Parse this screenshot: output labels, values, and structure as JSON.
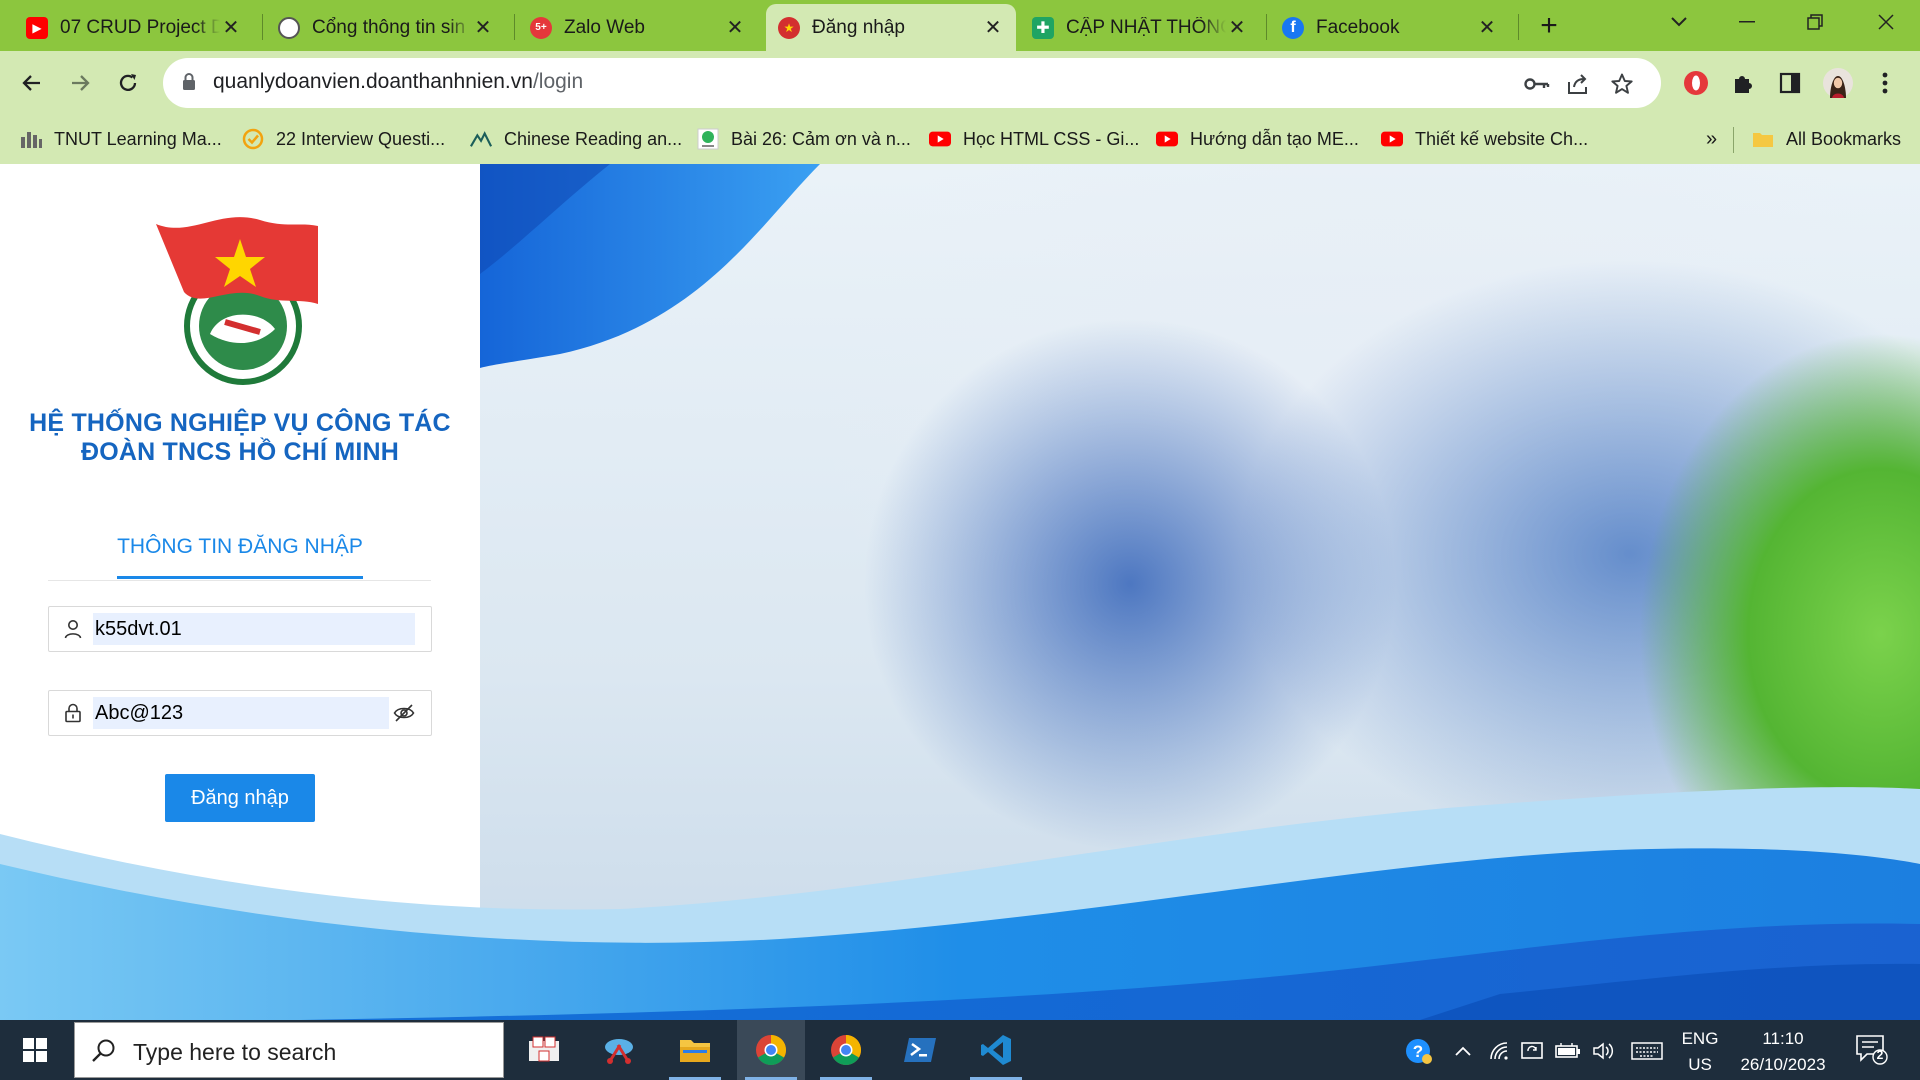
{
  "browser": {
    "tabs": [
      {
        "title": "07 CRUD Project D",
        "favicon": "youtube-icon",
        "active": false
      },
      {
        "title": "Cổng thông tin sin",
        "favicon": "university-icon",
        "active": false
      },
      {
        "title": "Zalo Web",
        "favicon": "zalo-icon",
        "active": false
      },
      {
        "title": "Đăng nhập",
        "favicon": "youth-union-icon",
        "active": true
      },
      {
        "title": "CẬP NHẬT THÔNG",
        "favicon": "sheets-icon",
        "active": false
      },
      {
        "title": "Facebook",
        "favicon": "facebook-icon",
        "active": false
      }
    ],
    "new_tab": "+",
    "address": {
      "host": "quanlydoanvien.doanthanhnien.vn",
      "path": "/login"
    },
    "bookmarks": [
      {
        "label": "TNUT Learning Ma...",
        "icon": "tnut-icon"
      },
      {
        "label": "22 Interview Questi...",
        "icon": "check-circle-icon"
      },
      {
        "label": "Chinese Reading an...",
        "icon": "mountain-icon"
      },
      {
        "label": "Bài 26: Cảm ơn và n...",
        "icon": "globe-icon"
      },
      {
        "label": "Học HTML CSS - Gi...",
        "icon": "youtube-icon"
      },
      {
        "label": "Hướng dẫn tạo ME...",
        "icon": "youtube-icon"
      },
      {
        "label": "Thiết kế website Ch...",
        "icon": "youtube-icon"
      }
    ],
    "bookmarks_overflow": "»",
    "all_bookmarks": "All Bookmarks"
  },
  "login": {
    "brand_line1": "HỆ THỐNG NGHIỆP VỤ CÔNG TÁC",
    "brand_line2": "ĐOÀN TNCS HỒ CHÍ MINH",
    "tab_title": "THÔNG TIN ĐĂNG NHẬP",
    "username": "k55dvt.01",
    "password": "Abc@123",
    "submit_label": "Đăng nhập"
  },
  "taskbar": {
    "search_placeholder": "Type here to search",
    "lang_line1": "ENG",
    "lang_line2": "US",
    "time": "11:10",
    "date": "26/10/2023",
    "notification_count": "2"
  },
  "colors": {
    "browser_frame": "#8cc63e",
    "toolbar": "#d3e9b3",
    "accent_blue": "#1a88e8",
    "brand_blue": "#1565c0",
    "taskbar": "#1e2d3c"
  }
}
